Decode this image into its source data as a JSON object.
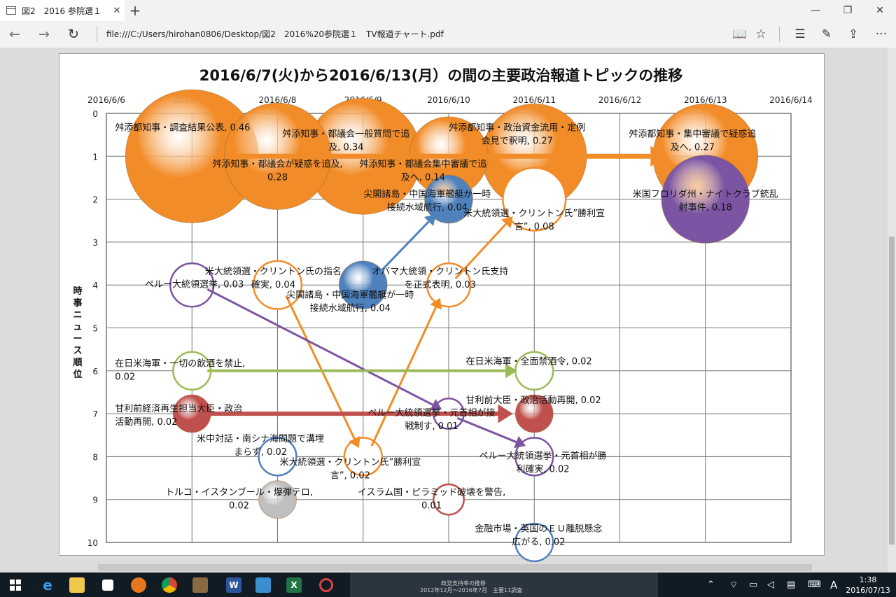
{
  "browser": {
    "tab_title": "図2　2016 参院選１　T",
    "tab_close": "✕",
    "new_tab": "+",
    "minimize": "—",
    "maximize": "❐",
    "close": "✕",
    "url": "file:///C:/Users/hirohan0806/Desktop/図2　2016%20参院選１　TV報道チャート.pdf",
    "icons": {
      "back": "←",
      "forward": "→",
      "refresh": "↻",
      "reading": "📖",
      "favorite": "☆",
      "hub": "☰",
      "note": "✎",
      "share": "⇪",
      "more": "···"
    }
  },
  "taskbar": {
    "time": "1:38",
    "date": "2016/07/13",
    "ime": "A",
    "preview_title": "政党支持率の推移",
    "preview_sub": "2012年12月～2016年7月　主要11調査"
  },
  "chart_data": {
    "type": "bubble",
    "title": "2016/6/7(火)から2016/6/13(月）の間の主要政治報道トピックの推移",
    "ylabel": "時事ニュース順位",
    "x_ticks": [
      "2016/6/6",
      "2016/6/7",
      "2016/6/8",
      "2016/6/9",
      "2016/6/10",
      "2016/6/11",
      "2016/6/12",
      "2016/6/13",
      "2016/6/14"
    ],
    "y_ticks": [
      "0",
      "1",
      "2",
      "3",
      "4",
      "5",
      "6",
      "7",
      "8",
      "9",
      "10"
    ],
    "xlim": [
      0,
      8
    ],
    "ylim": [
      0,
      10
    ],
    "grid": true,
    "colors": {
      "orange": "#f28c28",
      "blue": "#4f81bd",
      "purple": "#7b55a3",
      "green": "#9bbb59",
      "red": "#c0504d",
      "grey": "#bfbfbf"
    },
    "bubbles": [
      {
        "x": 1,
        "y": 1,
        "v": 0.46,
        "color": "orange",
        "fill": true,
        "label": "舛添都知事・調査結果公表, 0.46",
        "lx": 0.1,
        "ly": 0.4,
        "anchor": "start"
      },
      {
        "x": 2,
        "y": 1,
        "v": 0.28,
        "color": "orange",
        "fill": true,
        "label": "舛添知事・都議会が疑惑を追及,\n0.28",
        "lx": 2.0,
        "ly": 1.25,
        "anchor": "middle"
      },
      {
        "x": 3,
        "y": 1,
        "v": 0.34,
        "color": "orange",
        "fill": true,
        "label": "舛添知事・都議会一般質問で追\n及, 0.34",
        "lx": 2.8,
        "ly": 0.55,
        "anchor": "middle"
      },
      {
        "x": 4,
        "y": 1,
        "v": 0.14,
        "color": "orange",
        "fill": true,
        "label": "舛添知事・都議会集中審議で追\n及へ, 0.14",
        "lx": 3.7,
        "ly": 1.25,
        "anchor": "middle"
      },
      {
        "x": 5,
        "y": 1,
        "v": 0.27,
        "color": "orange",
        "fill": true,
        "label": "舛添都知事・政治資金流用・定例\n会見で釈明, 0.27",
        "lx": 4.8,
        "ly": 0.4,
        "anchor": "middle"
      },
      {
        "x": 7,
        "y": 1,
        "v": 0.27,
        "color": "orange",
        "fill": true,
        "label": "舛添都知事・集中審議で疑惑追\n及へ, 0.27",
        "lx": 6.85,
        "ly": 0.55,
        "anchor": "middle"
      },
      {
        "x": 7,
        "y": 2,
        "v": 0.18,
        "color": "purple",
        "fill": true,
        "label": "米国フロリダ州・ナイトクラブ銃乱\n射事件, 0.18",
        "lx": 7.0,
        "ly": 1.95,
        "anchor": "middle"
      },
      {
        "x": 4,
        "y": 2,
        "v": 0.04,
        "color": "blue",
        "fill": true,
        "label": "尖閣諸島・中国海軍艦艇が一時\n接続水域航行, 0.04",
        "lx": 3.75,
        "ly": 1.95,
        "anchor": "middle"
      },
      {
        "x": 5,
        "y": 2,
        "v": 0.08,
        "color": "orange",
        "fill": false,
        "label": "米大統領選・クリントン氏”勝利宣\n言”, 0.08",
        "lx": 5.0,
        "ly": 2.4,
        "anchor": "middle"
      },
      {
        "x": 1,
        "y": 4,
        "v": 0.03,
        "color": "purple",
        "fill": false,
        "label": "ペルー大統領選挙, 0.03",
        "lx": 0.45,
        "ly": 4.05,
        "anchor": "start"
      },
      {
        "x": 2,
        "y": 4,
        "v": 0.04,
        "color": "orange",
        "fill": false,
        "label": "米大統領選・クリントン氏の指名\n確実, 0.04",
        "lx": 1.95,
        "ly": 3.75,
        "anchor": "middle"
      },
      {
        "x": 3,
        "y": 4,
        "v": 0.04,
        "color": "blue",
        "fill": true,
        "label": "尖閣諸島・中国海軍艦艇が一時\n接続水域航行, 0.04",
        "lx": 2.85,
        "ly": 4.3,
        "anchor": "middle"
      },
      {
        "x": 4,
        "y": 4,
        "v": 0.03,
        "color": "orange",
        "fill": false,
        "label": "オバマ大統領・クリントン氏支持\nを正式表明, 0.03",
        "lx": 3.9,
        "ly": 3.75,
        "anchor": "middle"
      },
      {
        "x": 1,
        "y": 6,
        "v": 0.02,
        "color": "green",
        "fill": false,
        "label": "在日米海軍・一切の飲酒を禁止,\n0.02",
        "lx": 0.1,
        "ly": 5.9,
        "anchor": "start"
      },
      {
        "x": 5,
        "y": 6,
        "v": 0.02,
        "color": "green",
        "fill": false,
        "label": "在日米海軍・全面禁酒令, 0.02",
        "lx": 4.2,
        "ly": 5.85,
        "anchor": "start"
      },
      {
        "x": 1,
        "y": 7,
        "v": 0.02,
        "color": "red",
        "fill": true,
        "label": "甘利前経済再生担当大臣・政治\n活動再開, 0.02",
        "lx": 0.1,
        "ly": 6.95,
        "anchor": "start"
      },
      {
        "x": 5,
        "y": 7,
        "v": 0.02,
        "color": "red",
        "fill": true,
        "label": "甘利前大臣・政治活動再開, 0.02",
        "lx": 4.2,
        "ly": 6.75,
        "anchor": "start"
      },
      {
        "x": 4,
        "y": 7,
        "v": 0.01,
        "color": "purple",
        "fill": false,
        "label": "ペルー大統領選挙・元首相が接\n戦制す, 0.01",
        "lx": 3.8,
        "ly": 7.05,
        "anchor": "middle"
      },
      {
        "x": 2,
        "y": 8,
        "v": 0.02,
        "color": "blue",
        "fill": false,
        "label": "米中対話・南シナ海問題で溝埋\nまらず, 0.02",
        "lx": 1.8,
        "ly": 7.65,
        "anchor": "middle"
      },
      {
        "x": 3,
        "y": 8,
        "v": 0.02,
        "color": "orange",
        "fill": false,
        "label": "米大統領選・クリントン氏”勝利宣\n言”, 0.02",
        "lx": 2.85,
        "ly": 8.2,
        "anchor": "middle"
      },
      {
        "x": 5,
        "y": 8,
        "v": 0.02,
        "color": "purple",
        "fill": false,
        "label": "ペルー大統領選挙・元首相が勝\n利確実, 0.02",
        "lx": 5.1,
        "ly": 8.05,
        "anchor": "middle"
      },
      {
        "x": 2,
        "y": 9,
        "v": 0.02,
        "color": "grey",
        "fill": true,
        "label": "トルコ・イスタンブール・爆弾テロ,\n0.02",
        "lx": 1.55,
        "ly": 8.9,
        "anchor": "middle"
      },
      {
        "x": 4,
        "y": 9,
        "v": 0.01,
        "color": "red",
        "fill": false,
        "label": "イスラム国・ピラミッド破壊を警告,\n0.01",
        "lx": 3.8,
        "ly": 8.9,
        "anchor": "middle"
      },
      {
        "x": 5,
        "y": 10,
        "v": 0.02,
        "color": "blue",
        "fill": false,
        "label": "金融市場・英国のＥＵ離脱懸念\n広がる, 0.02",
        "lx": 5.05,
        "ly": 9.75,
        "anchor": "middle"
      }
    ],
    "arrows": [
      {
        "from": [
          1.5,
          1
        ],
        "to": [
          6.55,
          1
        ],
        "color": "orange",
        "width": 7
      },
      {
        "from": [
          3.1,
          3.9
        ],
        "to": [
          3.85,
          2.35
        ],
        "color": "blue",
        "width": 3
      },
      {
        "from": [
          4.08,
          3.85
        ],
        "to": [
          4.75,
          2.4
        ],
        "color": "orange",
        "width": 3
      },
      {
        "from": [
          2.1,
          4.25
        ],
        "to": [
          2.95,
          7.8
        ],
        "color": "orange",
        "width": 3
      },
      {
        "from": [
          3.1,
          7.75
        ],
        "to": [
          3.9,
          4.3
        ],
        "color": "orange",
        "width": 3
      },
      {
        "from": [
          1.18,
          4.1
        ],
        "to": [
          3.92,
          6.9
        ],
        "color": "purple",
        "width": 3
      },
      {
        "from": [
          4.1,
          7.1
        ],
        "to": [
          4.9,
          7.75
        ],
        "color": "purple",
        "width": 3
      },
      {
        "from": [
          1.18,
          6
        ],
        "to": [
          4.8,
          6
        ],
        "color": "green",
        "width": 4
      },
      {
        "from": [
          1.18,
          7
        ],
        "to": [
          4.75,
          7
        ],
        "color": "red",
        "width": 6
      }
    ]
  }
}
